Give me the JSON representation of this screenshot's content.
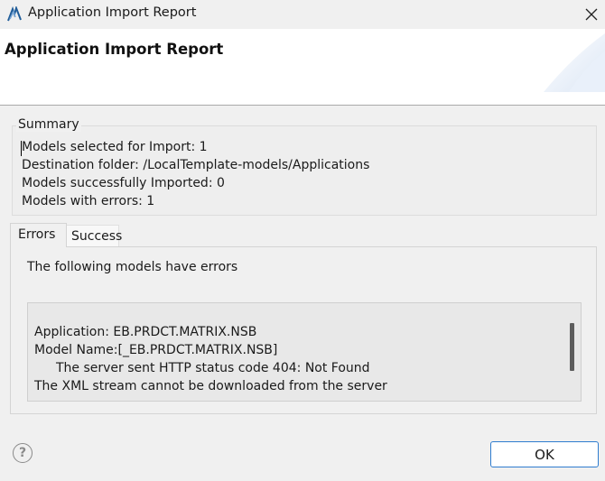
{
  "window": {
    "title": "Application Import Report",
    "icon": "app-icon",
    "close_icon": "close-icon"
  },
  "header": {
    "title": "Application Import Report"
  },
  "summary": {
    "legend": "Summary",
    "lines": [
      "Models selected for Import: 1",
      "Destination folder: /LocalTemplate-models/Applications",
      "Models successfully Imported: 0",
      "Models with errors: 1"
    ]
  },
  "tabs": [
    {
      "label": "Errors",
      "selected": true
    },
    {
      "label": "Success",
      "selected": false
    }
  ],
  "errors_panel": {
    "message": "The following models have errors",
    "details": [
      "Application: EB.PRDCT.MATRIX.NSB",
      "Model Name:[_EB.PRDCT.MATRIX.NSB]",
      "The server sent HTTP status code 404: Not Found",
      "The XML stream cannot be downloaded from the server"
    ]
  },
  "footer": {
    "help_icon": "help-icon",
    "ok_label": "OK"
  },
  "colors": {
    "background": "#f0f0f0",
    "header_background": "#ffffff",
    "ok_border": "#2f7ccf"
  }
}
